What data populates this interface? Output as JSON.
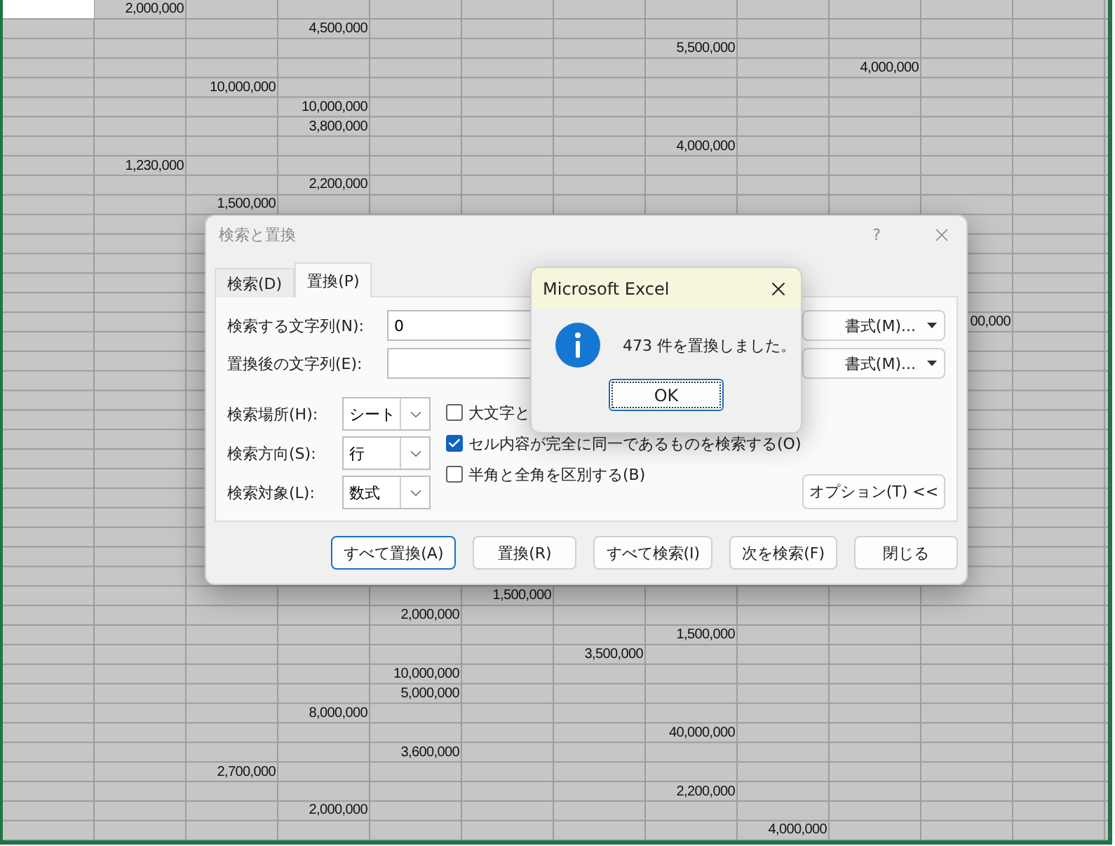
{
  "sheet": {
    "rows": [
      {
        "cells": [
          {
            "selected": true
          },
          "2,000,000"
        ]
      },
      {
        "cells": [
          null,
          null,
          null,
          "4,500,000"
        ]
      },
      {
        "cells": [
          null,
          null,
          null,
          null,
          null,
          null,
          null,
          "5,500,000"
        ]
      },
      {
        "cells": [
          null,
          null,
          null,
          null,
          null,
          null,
          null,
          null,
          null,
          "4,000,000"
        ]
      },
      {
        "cells": [
          null,
          null,
          "10,000,000"
        ]
      },
      {
        "cells": [
          null,
          null,
          null,
          "10,000,000"
        ]
      },
      {
        "cells": [
          null,
          null,
          null,
          "3,800,000"
        ]
      },
      {
        "cells": [
          null,
          null,
          null,
          null,
          null,
          null,
          null,
          "4,000,000"
        ]
      },
      {
        "cells": [
          null,
          "1,230,000"
        ]
      },
      {
        "cells": [
          null,
          null,
          null,
          "2,200,000"
        ]
      },
      {
        "cells": [
          null,
          null,
          "1,500,000"
        ]
      },
      {},
      {},
      {},
      {},
      {},
      {
        "cells": [
          null,
          null,
          null,
          null,
          null,
          null,
          null,
          null,
          null,
          null,
          "00,000"
        ]
      },
      {},
      {},
      {},
      {},
      {},
      {},
      {},
      {},
      {},
      {},
      {},
      {},
      {},
      {
        "cells": [
          null,
          null,
          null,
          null,
          null,
          "1,500,000"
        ]
      },
      {
        "cells": [
          null,
          null,
          null,
          null,
          "2,000,000"
        ]
      },
      {
        "cells": [
          null,
          null,
          null,
          null,
          null,
          null,
          null,
          "1,500,000"
        ]
      },
      {
        "cells": [
          null,
          null,
          null,
          null,
          null,
          null,
          "3,500,000"
        ]
      },
      {
        "cells": [
          null,
          null,
          null,
          null,
          "10,000,000"
        ]
      },
      {
        "cells": [
          null,
          null,
          null,
          null,
          "5,000,000"
        ]
      },
      {
        "cells": [
          null,
          null,
          null,
          "8,000,000"
        ]
      },
      {
        "cells": [
          null,
          null,
          null,
          null,
          null,
          null,
          null,
          "40,000,000"
        ]
      },
      {
        "cells": [
          null,
          null,
          null,
          null,
          "3,600,000"
        ]
      },
      {
        "cells": [
          null,
          null,
          "2,700,000"
        ]
      },
      {
        "cells": [
          null,
          null,
          null,
          null,
          null,
          null,
          null,
          "2,200,000"
        ]
      },
      {
        "cells": [
          null,
          null,
          null,
          "2,000,000"
        ]
      },
      {
        "cells": [
          null,
          null,
          null,
          null,
          null,
          null,
          null,
          null,
          "4,000,000"
        ]
      }
    ]
  },
  "dialog": {
    "title": "検索と置換",
    "help": "?",
    "tabs": [
      {
        "label": "検索(D)",
        "selected": false
      },
      {
        "label": "置換(P)",
        "selected": true
      }
    ],
    "fields": [
      {
        "label": "検索する文字列(N):",
        "value": "0",
        "format_button": "書式(M)..."
      },
      {
        "label": "置換後の文字列(E):",
        "format_button": "書式(M)..."
      }
    ],
    "selects": [
      {
        "label": "検索場所(H):",
        "value": "シート"
      },
      {
        "label": "検索方向(S):",
        "value": "行"
      },
      {
        "label": "検索対象(L):",
        "value": "数式"
      }
    ],
    "checkboxes": [
      {
        "label": "大文字と",
        "checked": false
      },
      {
        "label": "セル内容が完全に同一であるものを検索する(O)",
        "checked": true
      },
      {
        "label": "半角と全角を区別する(B)",
        "checked": false
      }
    ],
    "options_button": "オプション(T) <<",
    "buttons": [
      {
        "label": "すべて置換(A)",
        "default": true
      },
      {
        "label": "置換(R)",
        "default": false
      },
      {
        "label": "すべて検索(I)",
        "default": false
      },
      {
        "label": "次を検索(F)",
        "default": false
      },
      {
        "label": "閉じる",
        "default": false
      }
    ]
  },
  "message_box": {
    "title": "Microsoft Excel",
    "message": "473 件を置換しました。",
    "button": "OK"
  }
}
